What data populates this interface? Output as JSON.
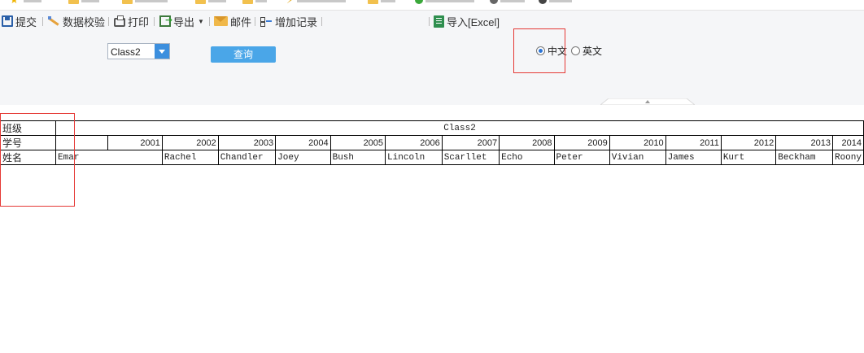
{
  "toolbar": {
    "submit_label": "提交",
    "validate_label": "数据校验",
    "print_label": "打印",
    "export_label": "导出",
    "mail_label": "邮件",
    "add_record_label": "增加记录",
    "import_excel_label": "导入[Excel]"
  },
  "params": {
    "class_select_value": "Class2",
    "query_button_label": "查询",
    "lang_options": [
      {
        "label": "中文",
        "selected": true
      },
      {
        "label": "英文",
        "selected": false
      }
    ]
  },
  "report": {
    "row_labels": {
      "class": "班级",
      "student_id": "学号",
      "name": "姓名"
    },
    "class_value": "Class2",
    "ids": [
      "2001",
      "2002",
      "2003",
      "2004",
      "2005",
      "2006",
      "2007",
      "2008",
      "2009",
      "2010",
      "2011",
      "2012",
      "2013",
      "2014"
    ],
    "names": [
      "Emar",
      "Rachel",
      "Chandler",
      "Joey",
      "Bush",
      "Lincoln",
      "Scarllet",
      "Echo",
      "Peter",
      "Vivian",
      "James",
      "Kurt",
      "Beckham",
      "Roony"
    ]
  },
  "colors": {
    "accent": "#4aa6e8",
    "highlight_box": "#e53935",
    "toolbar_bg": "#f5f6f8"
  }
}
